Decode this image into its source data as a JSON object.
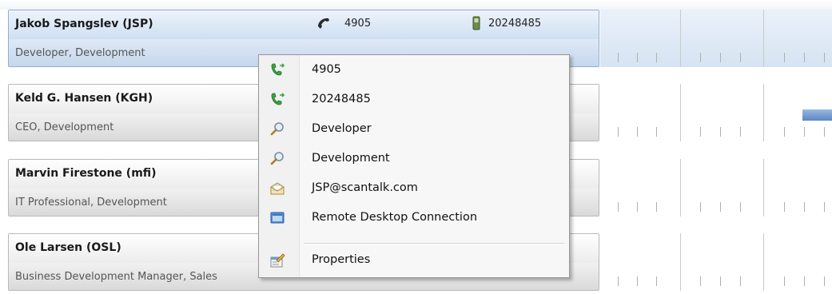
{
  "contacts": [
    {
      "name": "Jakob Spangslev (JSP)",
      "role": "Developer, Development",
      "phone": "4905",
      "mobile": "20248485",
      "selected": true
    },
    {
      "name": "Keld G. Hansen (KGH)",
      "role": "CEO, Development"
    },
    {
      "name": "Marvin Firestone (mfi)",
      "role": "IT Professional, Development"
    },
    {
      "name": "Ole Larsen (OSL)",
      "role": "Business Development Manager, Sales"
    }
  ],
  "context_menu": {
    "items": [
      {
        "label": "4905",
        "icon": "call-phone-icon"
      },
      {
        "label": "20248485",
        "icon": "call-phone-icon"
      },
      {
        "label": "Developer",
        "icon": "search-icon"
      },
      {
        "label": "Development",
        "icon": "search-icon"
      },
      {
        "label": "JSP@scantalk.com",
        "icon": "mail-icon"
      },
      {
        "label": "Remote Desktop Connection",
        "icon": "remote-desktop-icon"
      },
      {
        "label": "Properties",
        "icon": "properties-icon"
      }
    ]
  },
  "colors": {
    "selected_row": "#cfdff2",
    "calendar_bar": "#5a86c4",
    "call_green": "#3aa641"
  }
}
